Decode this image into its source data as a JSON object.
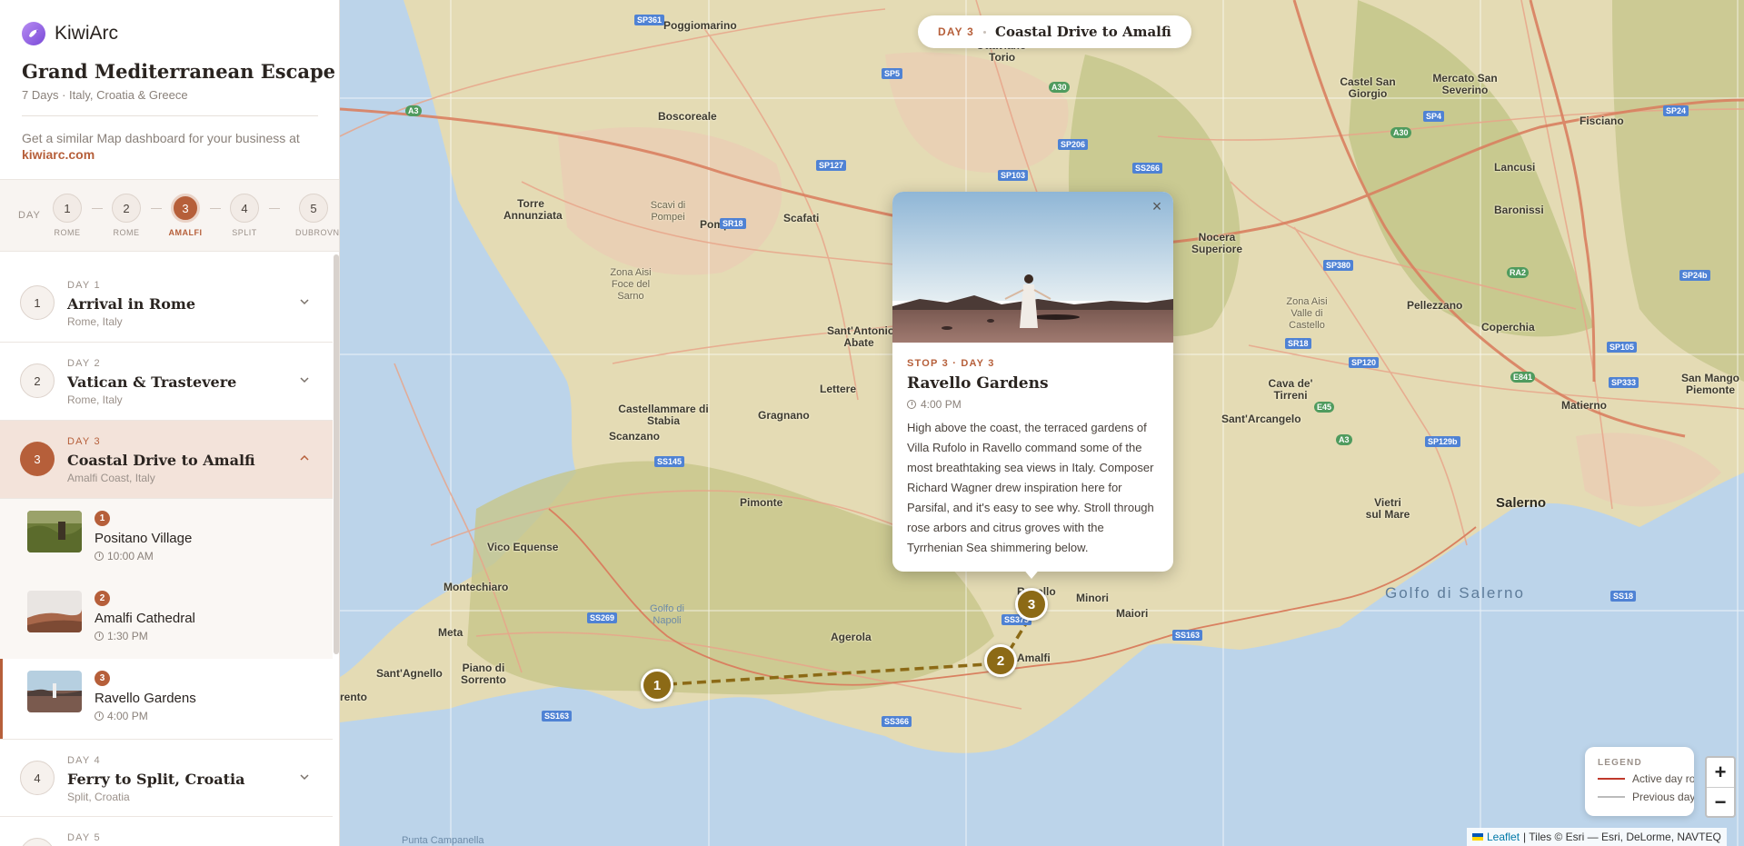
{
  "app": {
    "name": "KiwiArc"
  },
  "trip": {
    "title": "Grand Mediterranean Escape",
    "subtitle": "7 Days · Italy, Croatia & Greece",
    "promo_text": "Get a similar Map dashboard for your business at",
    "promo_link": "kiwiarc.com"
  },
  "day_selector": {
    "label": "DAY",
    "steps": [
      {
        "num": "1",
        "label": "ROME",
        "active": false
      },
      {
        "num": "2",
        "label": "ROME",
        "active": false
      },
      {
        "num": "3",
        "label": "AMALFI",
        "active": true
      },
      {
        "num": "4",
        "label": "SPLIT",
        "active": false
      },
      {
        "num": "5",
        "label": "DUBROVNIK",
        "active": false
      }
    ]
  },
  "days": [
    {
      "num": "1",
      "label": "DAY 1",
      "title": "Arrival in Rome",
      "location": "Rome, Italy",
      "expanded": false
    },
    {
      "num": "2",
      "label": "DAY 2",
      "title": "Vatican & Trastevere",
      "location": "Rome, Italy",
      "expanded": false
    },
    {
      "num": "3",
      "label": "DAY 3",
      "title": "Coastal Drive to Amalfi",
      "location": "Amalfi Coast, Italy",
      "expanded": true
    },
    {
      "num": "4",
      "label": "DAY 4",
      "title": "Ferry to Split, Croatia",
      "location": "Split, Croatia",
      "expanded": false
    },
    {
      "num": "5",
      "label": "DAY 5"
    }
  ],
  "stops": [
    {
      "num": "1",
      "title": "Positano Village",
      "time": "10:00 AM",
      "active": false
    },
    {
      "num": "2",
      "title": "Amalfi Cathedral",
      "time": "1:30 PM",
      "active": false
    },
    {
      "num": "3",
      "title": "Ravello Gardens",
      "time": "4:00 PM",
      "active": true
    }
  ],
  "map": {
    "header_day": "DAY 3",
    "header_title": "Coastal Drive to Amalfi",
    "popup": {
      "meta_stop": "STOP 3",
      "meta_day": "DAY 3",
      "title": "Ravello Gardens",
      "time": "4:00 PM",
      "body": "High above the coast, the terraced gardens of Villa Rufolo in Ravello command some of the most breathtaking sea views in Italy. Composer Richard Wagner drew inspiration here for Parsifal, and it's easy to see why. Stroll through rose arbors and citrus groves with the Tyrrhenian Sea shimmering below.",
      "close": "×"
    },
    "markers": [
      "1",
      "2",
      "3"
    ],
    "legend": {
      "title": "LEGEND",
      "active": "Active day route",
      "previous": "Previous days"
    },
    "zoom_in": "+",
    "zoom_out": "−",
    "attribution_link": "Leaflet",
    "attribution_text": "| Tiles © Esri — Esri, DeLorme, NAVTEQ",
    "places": {
      "poggiomarino": "Poggiomarino",
      "ottaviano": "Ottaviano",
      "torio": "Torio",
      "castel_san_giorgio": "Castel San Giorgio",
      "mercato": "Mercato San Severino",
      "fisciano": "Fisciano",
      "boscoreale": "Boscoreale",
      "torre": "Torre Annunziata",
      "scavi": "Scavi di Pompei",
      "pompei": "Pompei",
      "scafati": "Scafati",
      "zona_foce": "Zona Aisi Foce del Sarno",
      "lancusi": "Lancusi",
      "baronissi": "Baronissi",
      "nocera": "Nocera Superiore",
      "zona_valle": "Zona Aisi Valle di Castello",
      "pellezzano": "Pellezzano",
      "coperchia": "Coperchia",
      "santantonio": "Sant'Antonio Abate",
      "lettere": "Lettere",
      "castellammare": "Castellammare di Stabia",
      "gragnano": "Gragnano",
      "scanzano": "Scanzano",
      "cava": "Cava de' Tirreni",
      "santarcangelo": "Sant'Arcangelo",
      "matierno": "Matierno",
      "sanmango": "San Mango Piemonte",
      "pimonte": "Pimonte",
      "vietri": "Vietri sul Mare",
      "salerno": "Salerno",
      "vico": "Vico Equense",
      "montechiaro": "Montechiaro",
      "ravello": "Ravello",
      "minori": "Minori",
      "maiori": "Maiori",
      "golfo": "Golfo di Salerno",
      "meta": "Meta",
      "agerola": "Agerola",
      "amalfi": "Amalfi",
      "piano": "Piano di Sorrento",
      "santagnello": "Sant'Agnello",
      "sorrento": "Sorrento",
      "punta": "Punta Campanella",
      "napoli": "Golfo di Napoli"
    },
    "shields": {
      "sp361": "SP361",
      "a3": "A3",
      "sp5": "SP5",
      "a30": "A30",
      "sp4": "SP4",
      "sp24": "SP24",
      "sp206": "SP206",
      "sp127": "SP127",
      "sp103": "SP103",
      "ss266": "SS266",
      "sr18": "SR18",
      "sp380": "SP380",
      "ra2": "RA2",
      "sp24b": "SP24b",
      "sr18b": "SR18",
      "sp120": "SP120",
      "sp105": "SP105",
      "e841": "E841",
      "e45": "E45",
      "a3b": "A3",
      "sp333": "SP333",
      "sp129b": "SP129b",
      "ss145": "SS145",
      "ss269": "SS269",
      "ss373": "SS373",
      "ss163": "SS163",
      "ss163b": "SS163",
      "ss366": "SS366",
      "ss18": "SS18",
      "e45b": "45"
    }
  },
  "colors": {
    "accent": "#b65f3a",
    "marker": "#8c6a16",
    "route_active": "#c0392b",
    "route_previous": "#bbbbbb"
  }
}
